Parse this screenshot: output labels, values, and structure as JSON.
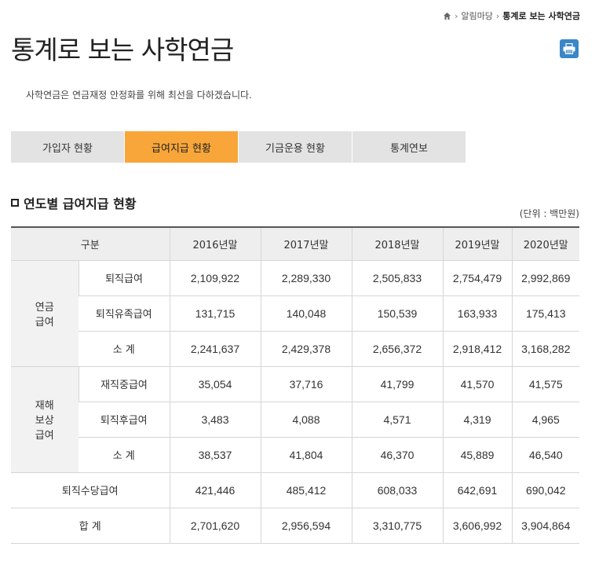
{
  "breadcrumb": {
    "items": [
      "알림마당",
      "통계로 보는 사학연금"
    ]
  },
  "page": {
    "title": "통계로 보는 사학연금",
    "subtitle": "사학연금은 연금재정 안정화를 위해 최선을 다하겠습니다."
  },
  "tabs": [
    {
      "label": "가입자 현황",
      "active": false
    },
    {
      "label": "급여지급 현황",
      "active": true
    },
    {
      "label": "기금운용 현황",
      "active": false
    },
    {
      "label": "통계연보",
      "active": false
    }
  ],
  "section": {
    "title": "연도별 급여지급 현황",
    "unit": "(단위 : 백만원)"
  },
  "table": {
    "header": {
      "category": "구분",
      "years": [
        "2016년말",
        "2017년말",
        "2018년말",
        "2019년말",
        "2020년말"
      ]
    },
    "groups": {
      "pension": "연금\n급여",
      "disaster": "재해\n보상\n급여"
    },
    "rows": [
      {
        "label": "퇴직급여",
        "values": [
          "2,109,922",
          "2,289,330",
          "2,505,833",
          "2,754,479",
          "2,992,869"
        ]
      },
      {
        "label": "퇴직유족급여",
        "values": [
          "131,715",
          "140,048",
          "150,539",
          "163,933",
          "175,413"
        ]
      },
      {
        "label": "소 계",
        "values": [
          "2,241,637",
          "2,429,378",
          "2,656,372",
          "2,918,412",
          "3,168,282"
        ]
      },
      {
        "label": "재직중급여",
        "values": [
          "35,054",
          "37,716",
          "41,799",
          "41,570",
          "41,575"
        ]
      },
      {
        "label": "퇴직후급여",
        "values": [
          "3,483",
          "4,088",
          "4,571",
          "4,319",
          "4,965"
        ]
      },
      {
        "label": "소 계",
        "values": [
          "38,537",
          "41,804",
          "46,370",
          "45,889",
          "46,540"
        ]
      },
      {
        "label": "퇴직수당급여",
        "values": [
          "421,446",
          "485,412",
          "608,033",
          "642,691",
          "690,042"
        ]
      },
      {
        "label": "합 계",
        "values": [
          "2,701,620",
          "2,956,594",
          "3,310,775",
          "3,606,992",
          "3,904,864"
        ]
      }
    ]
  }
}
